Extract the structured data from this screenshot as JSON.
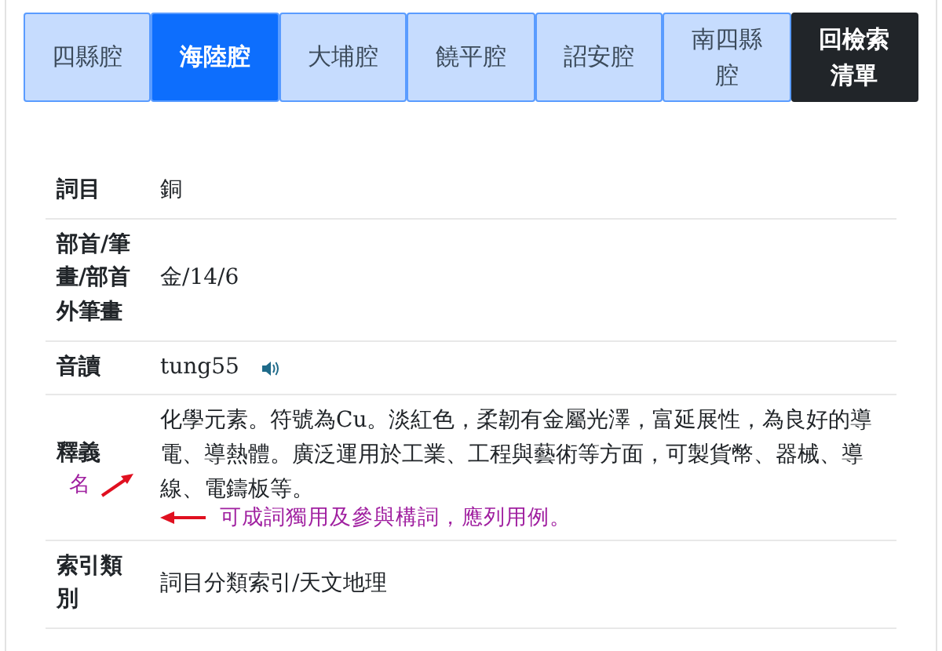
{
  "tabs": [
    {
      "label": "四縣腔",
      "kind": "dialect",
      "selected": false
    },
    {
      "label": "海陸腔",
      "kind": "dialect",
      "selected": true
    },
    {
      "label": "大埔腔",
      "kind": "dialect",
      "selected": false
    },
    {
      "label": "饒平腔",
      "kind": "dialect",
      "selected": false
    },
    {
      "label": "詔安腔",
      "kind": "dialect",
      "selected": false
    },
    {
      "label": "南四縣腔",
      "kind": "dialect",
      "selected": false
    },
    {
      "label": "回檢索清單",
      "kind": "return"
    }
  ],
  "entry": [
    {
      "label": "詞目",
      "value": "銅",
      "kind": "text"
    },
    {
      "label": "部首/筆畫/部首外筆畫",
      "value": "金/14/6",
      "kind": "text"
    },
    {
      "label": "音讀",
      "value": "tung55",
      "kind": "audio"
    },
    {
      "label": "釋義",
      "value": "化學元素。符號為Cu。淡紅色，柔韌有金屬光澤，富延展性，為良好的導電、導熱體。廣泛運用於工業、工程與藝術等方面，可製貨幣、器械、導線、電鑄板等。",
      "kind": "annotated",
      "label_note": "名",
      "value_note": "可成詞獨用及參與構詞，應列用例。"
    },
    {
      "label": "索引類別",
      "value": "詞目分類索引/天文地理",
      "kind": "text"
    }
  ]
}
